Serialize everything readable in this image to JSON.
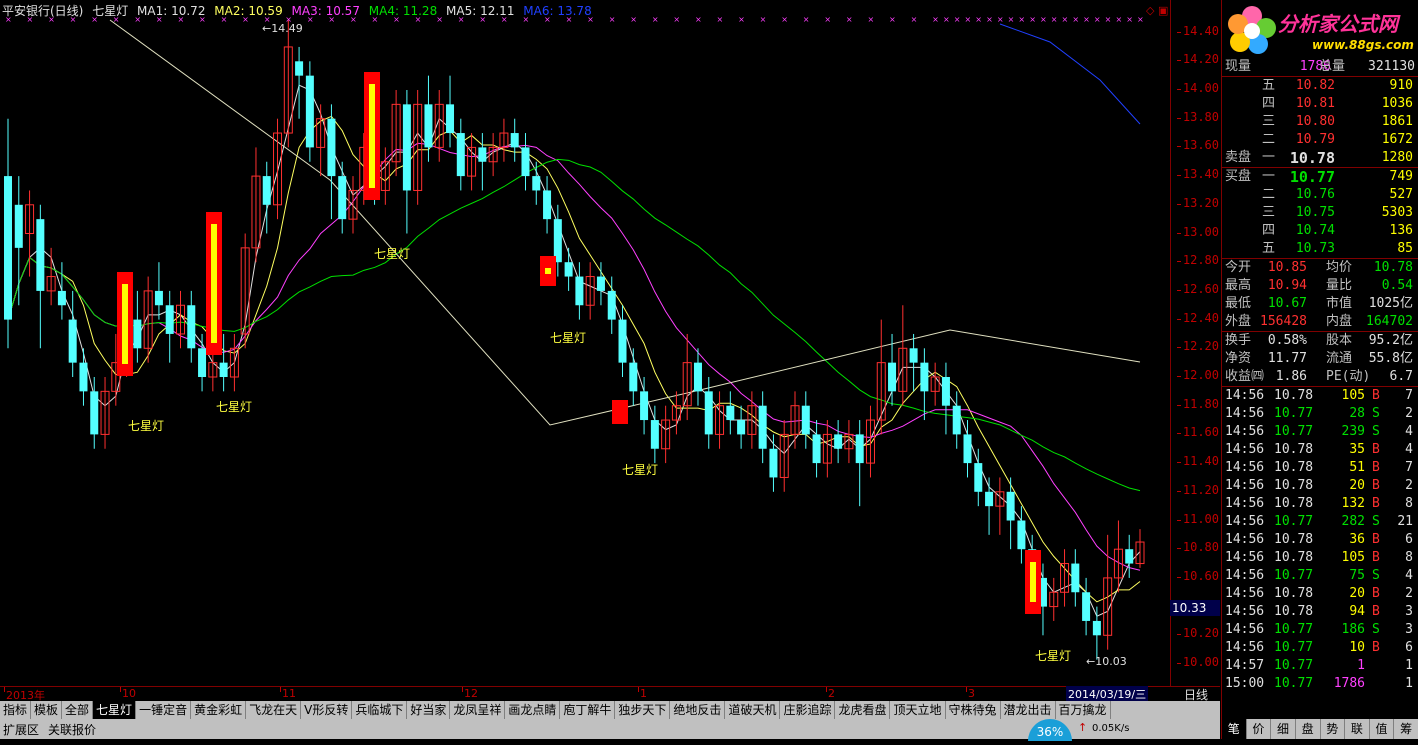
{
  "title": {
    "stock": "平安银行(日线)",
    "indicator": "七星灯",
    "ma": [
      {
        "label": "MA1: 10.72",
        "color": "#e0e0e0"
      },
      {
        "label": "MA2: 10.59",
        "color": "#ffff60"
      },
      {
        "label": "MA3: 10.57",
        "color": "#ff40ff"
      },
      {
        "label": "MA4: 11.28",
        "color": "#00e000"
      },
      {
        "label": "MA5: 12.11",
        "color": "#e0e0e0"
      },
      {
        "label": "MA6: 13.78",
        "color": "#2040ff"
      }
    ]
  },
  "price_ticks": [
    "14.40",
    "14.20",
    "14.00",
    "13.80",
    "13.60",
    "13.40",
    "13.20",
    "13.00",
    "12.80",
    "12.60",
    "12.40",
    "12.20",
    "12.00",
    "11.80",
    "11.60",
    "11.40",
    "11.20",
    "11.00",
    "10.80",
    "10.60",
    "10.40",
    "10.20",
    "10.00"
  ],
  "current_price": "10.33",
  "annotations": {
    "high": "14.49",
    "low": "10.03"
  },
  "signal_label": "七星灯",
  "date_axis": {
    "labels": [
      "2013年",
      "10",
      "11",
      "12",
      "1",
      "2",
      "3"
    ],
    "selected_date": "2014/03/19/三",
    "period": "日线"
  },
  "indicator_tabs": [
    "指标",
    "模板",
    "全部",
    "七星灯",
    "一锤定音",
    "黄金彩虹",
    "飞龙在天",
    "V形反转",
    "兵临城下",
    "好当家",
    "龙凤呈祥",
    "画龙点睛",
    "庖丁解牛",
    "独步天下",
    "绝地反击",
    "道破天机",
    "庄影追踪",
    "龙虎看盘",
    "顶天立地",
    "守株待兔",
    "潜龙出击",
    "百万擒龙"
  ],
  "active_tab": "七星灯",
  "status": {
    "left1": "扩展区",
    "left2": "关联报价",
    "progress": "36%",
    "speed": "0.05K/s"
  },
  "logo": {
    "text": "分析家公式网",
    "url": "www.88gs.com"
  },
  "quote": {
    "volume_label": "现量",
    "volume": "1786",
    "total_label": "总量",
    "total": "321130",
    "sell_label": "卖盘",
    "sells": [
      {
        "lvl": "五",
        "price": "10.82",
        "vol": "910"
      },
      {
        "lvl": "四",
        "price": "10.81",
        "vol": "1036"
      },
      {
        "lvl": "三",
        "price": "10.80",
        "vol": "1861"
      },
      {
        "lvl": "二",
        "price": "10.79",
        "vol": "1672"
      },
      {
        "lvl": "一",
        "price": "10.78",
        "vol": "1280"
      }
    ],
    "buy_label": "买盘",
    "buys": [
      {
        "lvl": "一",
        "price": "10.77",
        "vol": "749"
      },
      {
        "lvl": "二",
        "price": "10.76",
        "vol": "527"
      },
      {
        "lvl": "三",
        "price": "10.75",
        "vol": "5303"
      },
      {
        "lvl": "四",
        "price": "10.74",
        "vol": "136"
      },
      {
        "lvl": "五",
        "price": "10.73",
        "vol": "85"
      }
    ],
    "stats": [
      {
        "l1": "今开",
        "v1": "10.85",
        "c1": "red",
        "l2": "均价",
        "v2": "10.78",
        "c2": "green"
      },
      {
        "l1": "最高",
        "v1": "10.94",
        "c1": "red",
        "l2": "量比",
        "v2": "0.54",
        "c2": "green"
      },
      {
        "l1": "最低",
        "v1": "10.67",
        "c1": "green",
        "l2": "市值",
        "v2": "1025亿",
        "c2": "white"
      },
      {
        "l1": "外盘",
        "v1": "156428",
        "c1": "red",
        "l2": "内盘",
        "v2": "164702",
        "c2": "green"
      }
    ],
    "stats2": [
      {
        "l1": "换手",
        "v1": "0.58%",
        "l2": "股本",
        "v2": "95.2亿"
      },
      {
        "l1": "净资",
        "v1": "11.77",
        "l2": "流通",
        "v2": "55.8亿"
      },
      {
        "l1": "收益㈣",
        "v1": "1.86",
        "l2": "PE(动)",
        "v2": "6.7"
      }
    ],
    "ticks": [
      {
        "t": "14:56",
        "p": "10.78",
        "pc": "white",
        "v": "105",
        "s": "B",
        "n": "7"
      },
      {
        "t": "14:56",
        "p": "10.77",
        "pc": "green",
        "v": "28",
        "s": "S",
        "n": "2"
      },
      {
        "t": "14:56",
        "p": "10.77",
        "pc": "green",
        "v": "239",
        "s": "S",
        "n": "4"
      },
      {
        "t": "14:56",
        "p": "10.78",
        "pc": "white",
        "v": "35",
        "s": "B",
        "n": "4"
      },
      {
        "t": "14:56",
        "p": "10.78",
        "pc": "white",
        "v": "51",
        "s": "B",
        "n": "7"
      },
      {
        "t": "14:56",
        "p": "10.78",
        "pc": "white",
        "v": "20",
        "s": "B",
        "n": "2"
      },
      {
        "t": "14:56",
        "p": "10.78",
        "pc": "white",
        "v": "132",
        "s": "B",
        "n": "8"
      },
      {
        "t": "14:56",
        "p": "10.77",
        "pc": "green",
        "v": "282",
        "s": "S",
        "n": "21"
      },
      {
        "t": "14:56",
        "p": "10.78",
        "pc": "white",
        "v": "36",
        "s": "B",
        "n": "6"
      },
      {
        "t": "14:56",
        "p": "10.78",
        "pc": "white",
        "v": "105",
        "s": "B",
        "n": "8"
      },
      {
        "t": "14:56",
        "p": "10.77",
        "pc": "green",
        "v": "75",
        "s": "S",
        "n": "4"
      },
      {
        "t": "14:56",
        "p": "10.78",
        "pc": "white",
        "v": "20",
        "s": "B",
        "n": "2"
      },
      {
        "t": "14:56",
        "p": "10.78",
        "pc": "white",
        "v": "94",
        "s": "B",
        "n": "3"
      },
      {
        "t": "14:56",
        "p": "10.77",
        "pc": "green",
        "v": "186",
        "s": "S",
        "n": "3"
      },
      {
        "t": "14:56",
        "p": "10.77",
        "pc": "green",
        "v": "10",
        "s": "B",
        "n": "6"
      },
      {
        "t": "14:57",
        "p": "10.77",
        "pc": "green",
        "v": "1",
        "s": "",
        "n": "1"
      },
      {
        "t": "15:00",
        "p": "10.77",
        "pc": "green",
        "v": "1786",
        "s": "",
        "n": "1"
      }
    ]
  },
  "bottom_tabs": [
    "笔",
    "价",
    "细",
    "盘",
    "势",
    "联",
    "值",
    "筹"
  ],
  "colors": {
    "up": "#ff3030",
    "down": "#54ffff",
    "signal_red": "#ff0000",
    "signal_yellow": "#ffff00",
    "axis": "#c00000"
  }
}
